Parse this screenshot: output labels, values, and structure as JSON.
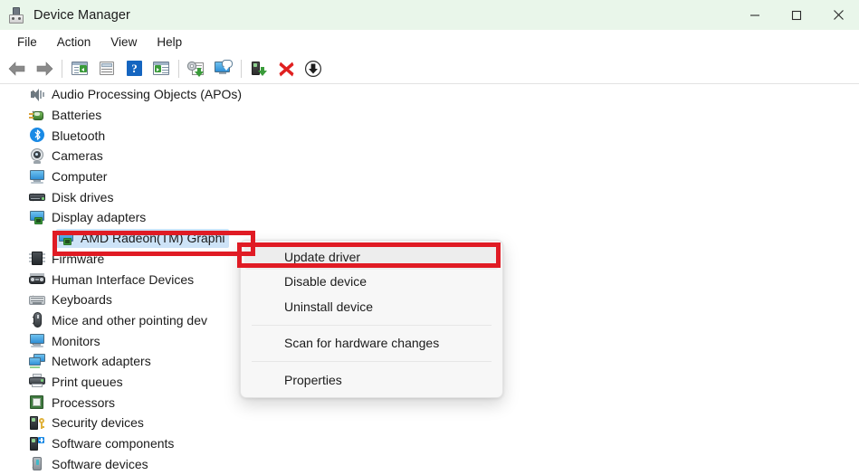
{
  "window": {
    "title": "Device Manager",
    "icon": "device-manager-icon",
    "titlebar_color": "#e9f6ea",
    "controls": [
      {
        "name": "minimize-button",
        "glyph": "minimize-icon"
      },
      {
        "name": "maximize-button",
        "glyph": "maximize-icon"
      },
      {
        "name": "close-button",
        "glyph": "close-icon"
      }
    ]
  },
  "menubar": {
    "items": [
      {
        "label": "File"
      },
      {
        "label": "Action"
      },
      {
        "label": "View"
      },
      {
        "label": "Help"
      }
    ]
  },
  "toolbar": {
    "items": [
      {
        "name": "back-icon",
        "type": "icon"
      },
      {
        "name": "forward-icon",
        "type": "icon"
      },
      {
        "name": "separator",
        "type": "separator"
      },
      {
        "name": "show-hide-console-tree-icon",
        "type": "icon"
      },
      {
        "name": "properties-icon",
        "type": "icon"
      },
      {
        "name": "help-icon",
        "type": "icon"
      },
      {
        "name": "details-view-icon",
        "type": "icon"
      },
      {
        "name": "separator",
        "type": "separator"
      },
      {
        "name": "update-driver-icon",
        "type": "icon"
      },
      {
        "name": "scan-for-hardware-changes-icon",
        "type": "icon"
      },
      {
        "name": "separator",
        "type": "separator"
      },
      {
        "name": "enable-device-icon",
        "type": "icon"
      },
      {
        "name": "uninstall-device-icon",
        "type": "icon"
      },
      {
        "name": "download-icon",
        "type": "icon"
      }
    ]
  },
  "tree": {
    "selection_color": "#cde3f7",
    "rows": [
      {
        "label": "Audio Processing Objects (APOs)",
        "icon": "speaker-icon",
        "expanded": false,
        "child": false,
        "selected": false
      },
      {
        "label": "Batteries",
        "icon": "battery-icon",
        "expanded": false,
        "child": false,
        "selected": false
      },
      {
        "label": "Bluetooth",
        "icon": "bluetooth-icon",
        "expanded": false,
        "child": false,
        "selected": false
      },
      {
        "label": "Cameras",
        "icon": "camera-icon",
        "expanded": false,
        "child": false,
        "selected": false
      },
      {
        "label": "Computer",
        "icon": "computer-icon",
        "expanded": false,
        "child": false,
        "selected": false
      },
      {
        "label": "Disk drives",
        "icon": "disk-drive-icon",
        "expanded": false,
        "child": false,
        "selected": false
      },
      {
        "label": "Display adapters",
        "icon": "display-adapter-icon",
        "expanded": true,
        "child": false,
        "selected": false
      },
      {
        "label": "AMD Radeon(TM) Graphi",
        "icon": "display-adapter-icon",
        "expanded": false,
        "child": true,
        "selected": true
      },
      {
        "label": "Firmware",
        "icon": "firmware-icon",
        "expanded": false,
        "child": false,
        "selected": false
      },
      {
        "label": "Human Interface Devices",
        "icon": "hid-icon",
        "expanded": false,
        "child": false,
        "selected": false
      },
      {
        "label": "Keyboards",
        "icon": "keyboard-icon",
        "expanded": false,
        "child": false,
        "selected": false
      },
      {
        "label": "Mice and other pointing dev",
        "icon": "mouse-icon",
        "expanded": false,
        "child": false,
        "selected": false
      },
      {
        "label": "Monitors",
        "icon": "monitor-icon",
        "expanded": false,
        "child": false,
        "selected": false
      },
      {
        "label": "Network adapters",
        "icon": "network-adapter-icon",
        "expanded": false,
        "child": false,
        "selected": false
      },
      {
        "label": "Print queues",
        "icon": "printer-icon",
        "expanded": false,
        "child": false,
        "selected": false
      },
      {
        "label": "Processors",
        "icon": "processor-icon",
        "expanded": false,
        "child": false,
        "selected": false
      },
      {
        "label": "Security devices",
        "icon": "security-device-icon",
        "expanded": false,
        "child": false,
        "selected": false
      },
      {
        "label": "Software components",
        "icon": "software-component-icon",
        "expanded": false,
        "child": false,
        "selected": false
      },
      {
        "label": "Software devices",
        "icon": "software-device-icon",
        "expanded": false,
        "child": false,
        "selected": false
      }
    ]
  },
  "context_menu": {
    "items": [
      {
        "type": "item",
        "label": "Update driver",
        "hover": true
      },
      {
        "type": "item",
        "label": "Disable device",
        "hover": false
      },
      {
        "type": "item",
        "label": "Uninstall device",
        "hover": false
      },
      {
        "type": "separator"
      },
      {
        "type": "item",
        "label": "Scan for hardware changes",
        "hover": false
      },
      {
        "type": "separator"
      },
      {
        "type": "item",
        "label": "Properties",
        "hover": false
      }
    ]
  },
  "annotations": {
    "color": "#e01b24",
    "boxes": [
      {
        "name": "device-highlight",
        "target": "AMD Radeon(TM) Graphi"
      },
      {
        "name": "update-driver-highlight",
        "target": "Update driver"
      }
    ]
  }
}
